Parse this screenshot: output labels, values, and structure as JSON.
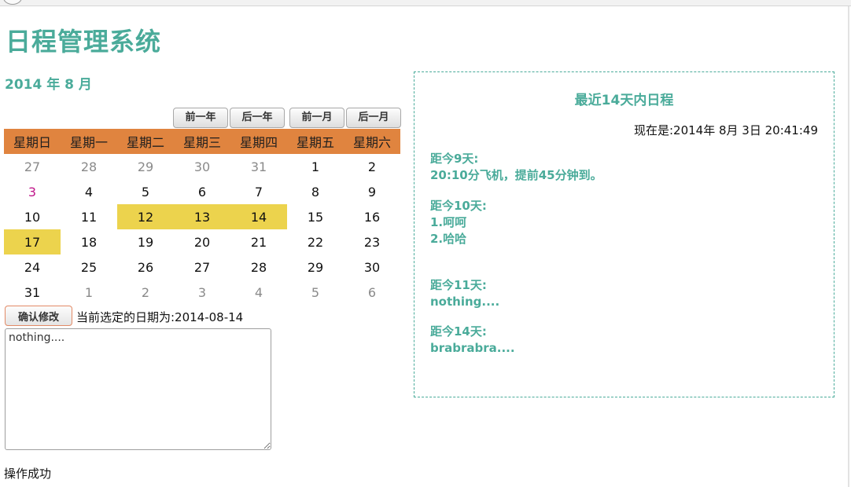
{
  "app": {
    "title": "日程管理系统"
  },
  "calendar": {
    "month_title": "2014 年 8 月",
    "nav": {
      "prev_year": "前一年",
      "next_year": "后一年",
      "prev_month": "前一月",
      "next_month": "后一月"
    },
    "weekdays": [
      "星期日",
      "星期一",
      "星期二",
      "星期三",
      "星期四",
      "星期五",
      "星期六"
    ],
    "weeks": [
      [
        {
          "d": "27",
          "t": "other"
        },
        {
          "d": "28",
          "t": "other"
        },
        {
          "d": "29",
          "t": "other"
        },
        {
          "d": "30",
          "t": "other"
        },
        {
          "d": "31",
          "t": "other"
        },
        {
          "d": "1",
          "t": ""
        },
        {
          "d": "2",
          "t": ""
        }
      ],
      [
        {
          "d": "3",
          "t": "today"
        },
        {
          "d": "4",
          "t": ""
        },
        {
          "d": "5",
          "t": ""
        },
        {
          "d": "6",
          "t": ""
        },
        {
          "d": "7",
          "t": ""
        },
        {
          "d": "8",
          "t": ""
        },
        {
          "d": "9",
          "t": ""
        }
      ],
      [
        {
          "d": "10",
          "t": ""
        },
        {
          "d": "11",
          "t": ""
        },
        {
          "d": "12",
          "t": "marked"
        },
        {
          "d": "13",
          "t": "marked"
        },
        {
          "d": "14",
          "t": "marked"
        },
        {
          "d": "15",
          "t": ""
        },
        {
          "d": "16",
          "t": ""
        }
      ],
      [
        {
          "d": "17",
          "t": "marked"
        },
        {
          "d": "18",
          "t": ""
        },
        {
          "d": "19",
          "t": ""
        },
        {
          "d": "20",
          "t": ""
        },
        {
          "d": "21",
          "t": ""
        },
        {
          "d": "22",
          "t": ""
        },
        {
          "d": "23",
          "t": ""
        }
      ],
      [
        {
          "d": "24",
          "t": ""
        },
        {
          "d": "25",
          "t": ""
        },
        {
          "d": "26",
          "t": ""
        },
        {
          "d": "27",
          "t": ""
        },
        {
          "d": "28",
          "t": ""
        },
        {
          "d": "29",
          "t": ""
        },
        {
          "d": "30",
          "t": ""
        }
      ],
      [
        {
          "d": "31",
          "t": ""
        },
        {
          "d": "1",
          "t": "other"
        },
        {
          "d": "2",
          "t": "other"
        },
        {
          "d": "3",
          "t": "other"
        },
        {
          "d": "4",
          "t": "other"
        },
        {
          "d": "5",
          "t": "other"
        },
        {
          "d": "6",
          "t": "other"
        }
      ]
    ]
  },
  "editor": {
    "confirm_label": "确认修改",
    "selected_text": "当前选定的日期为:2014-08-14",
    "note_value": "nothing....",
    "status": "操作成功"
  },
  "panel": {
    "title": "最近14天内日程",
    "now": "现在是:2014年 8月 3日 20:41:49",
    "entries": [
      {
        "lines": [
          "距今9天:",
          "20:10分飞机，提前45分钟到。"
        ]
      },
      {
        "lines": [
          "距今10天:",
          "1.呵呵",
          "2.哈哈"
        ]
      },
      {
        "lines": [
          "距今11天:",
          "nothing...."
        ]
      },
      {
        "lines": [
          "距今14天:",
          "brabrabra...."
        ]
      }
    ]
  },
  "colors": {
    "accent": "#4aab9a",
    "header_bg": "#e0843f",
    "marked_bg": "#ecd34d",
    "today_text": "#c0178a"
  }
}
